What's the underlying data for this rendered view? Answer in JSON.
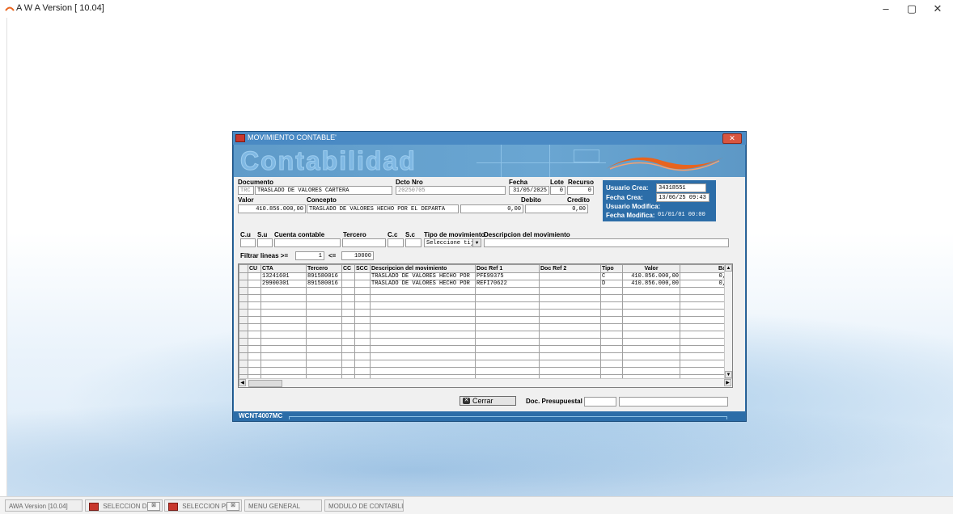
{
  "window": {
    "title": "A W A Version [ 10.04]",
    "minimize": "–",
    "maximize": "▢",
    "close": "✕"
  },
  "taskbar": [
    {
      "label": "AWA Version [10.04]"
    },
    {
      "label": "SELECCION DE ...",
      "close": "⊠"
    },
    {
      "label": "SELECCION PER...",
      "close": "⊠"
    },
    {
      "label": "MENU GENERAL"
    },
    {
      "label": "MODULO DE CONTABILI..."
    }
  ],
  "dialog": {
    "title": "MOVIMIENTO CONTABLE'",
    "close": "✕",
    "banner_title": "Contabilidad",
    "footer_code": "WCNT4007MC"
  },
  "form": {
    "documento_label": "Documento",
    "documento_code": "TRC",
    "documento_desc": "TRASLADO DE VALORES CARTERA",
    "dcto_nro_label": "Dcto Nro",
    "dcto_nro": "20250705",
    "fecha_label": "Fecha",
    "fecha": "31/05/2025",
    "lote_label": "Lote",
    "lote": "0",
    "recurso_label": "Recurso",
    "recurso": "0",
    "valor_label": "Valor",
    "valor": "410.856.000,00",
    "concepto_label": "Concepto",
    "concepto": "TRASLADO DE VALORES HECHO POR EL DEPARTA",
    "debito_label": "Debito",
    "debito": "0,00",
    "credito_label": "Credito",
    "credito": "0,00",
    "usuario_crea_label": "Usuario Crea:",
    "usuario_crea": "34318551",
    "fecha_crea_label": "Fecha Crea:",
    "fecha_crea": "13/06/25 09:43",
    "usuario_modifica_label": "Usuario Modifica:",
    "fecha_modifica_label": "Fecha Modifica:",
    "fecha_modifica": "01/01/01 00:00",
    "cu_label": "C.u",
    "su_label": "S.u",
    "cuenta_label": "Cuenta contable",
    "tercero_label": "Tercero",
    "cc_label": "C.c",
    "sc_label": "S.c",
    "tipo_mov_label": "Tipo de movimiento",
    "tipo_mov_value": "Seleccione tij",
    "desc_mov_label": "Descripcion del movimiento",
    "filtrar_label": "Filtrar  lineas >=",
    "filtrar_from": "1",
    "lte_label": "<=",
    "filtrar_to": "10000"
  },
  "grid": {
    "columns": [
      "CU",
      "CTA",
      "Tercero",
      "CC",
      "SCC",
      "Descripcion del movimiento",
      "Doc Ref 1",
      "Doc Ref 2",
      "Tipo",
      "Valor",
      "Ba"
    ],
    "rows": [
      [
        "",
        "13241601",
        "891580016",
        "",
        "",
        "TRASLADO DE VALORES HECHO POR",
        "PFE99375",
        "",
        "C",
        "410.856.000,00",
        "0,"
      ],
      [
        "",
        "29900301",
        "891580016",
        "",
        "",
        "TRASLADO DE VALORES HECHO POR",
        "REFI70622",
        "",
        "D",
        "410.856.000,00",
        "0,"
      ]
    ],
    "empty_rows": 14
  },
  "bottom": {
    "cerrar_label": "Cerrar",
    "doc_presupuestal_label": "Doc. Presupuestal"
  },
  "colors": {
    "dialog_blue": "#2c6da8",
    "banner_blue": "#6aa6d2",
    "wave_orange": "#e8641e"
  },
  "icons": [
    "app-icon",
    "dialog-icon",
    "close-icon",
    "cerrar-icon",
    "dropdown-arrow-icon",
    "scroll-left-icon",
    "scroll-right-icon",
    "scroll-up-icon",
    "scroll-down-icon"
  ]
}
